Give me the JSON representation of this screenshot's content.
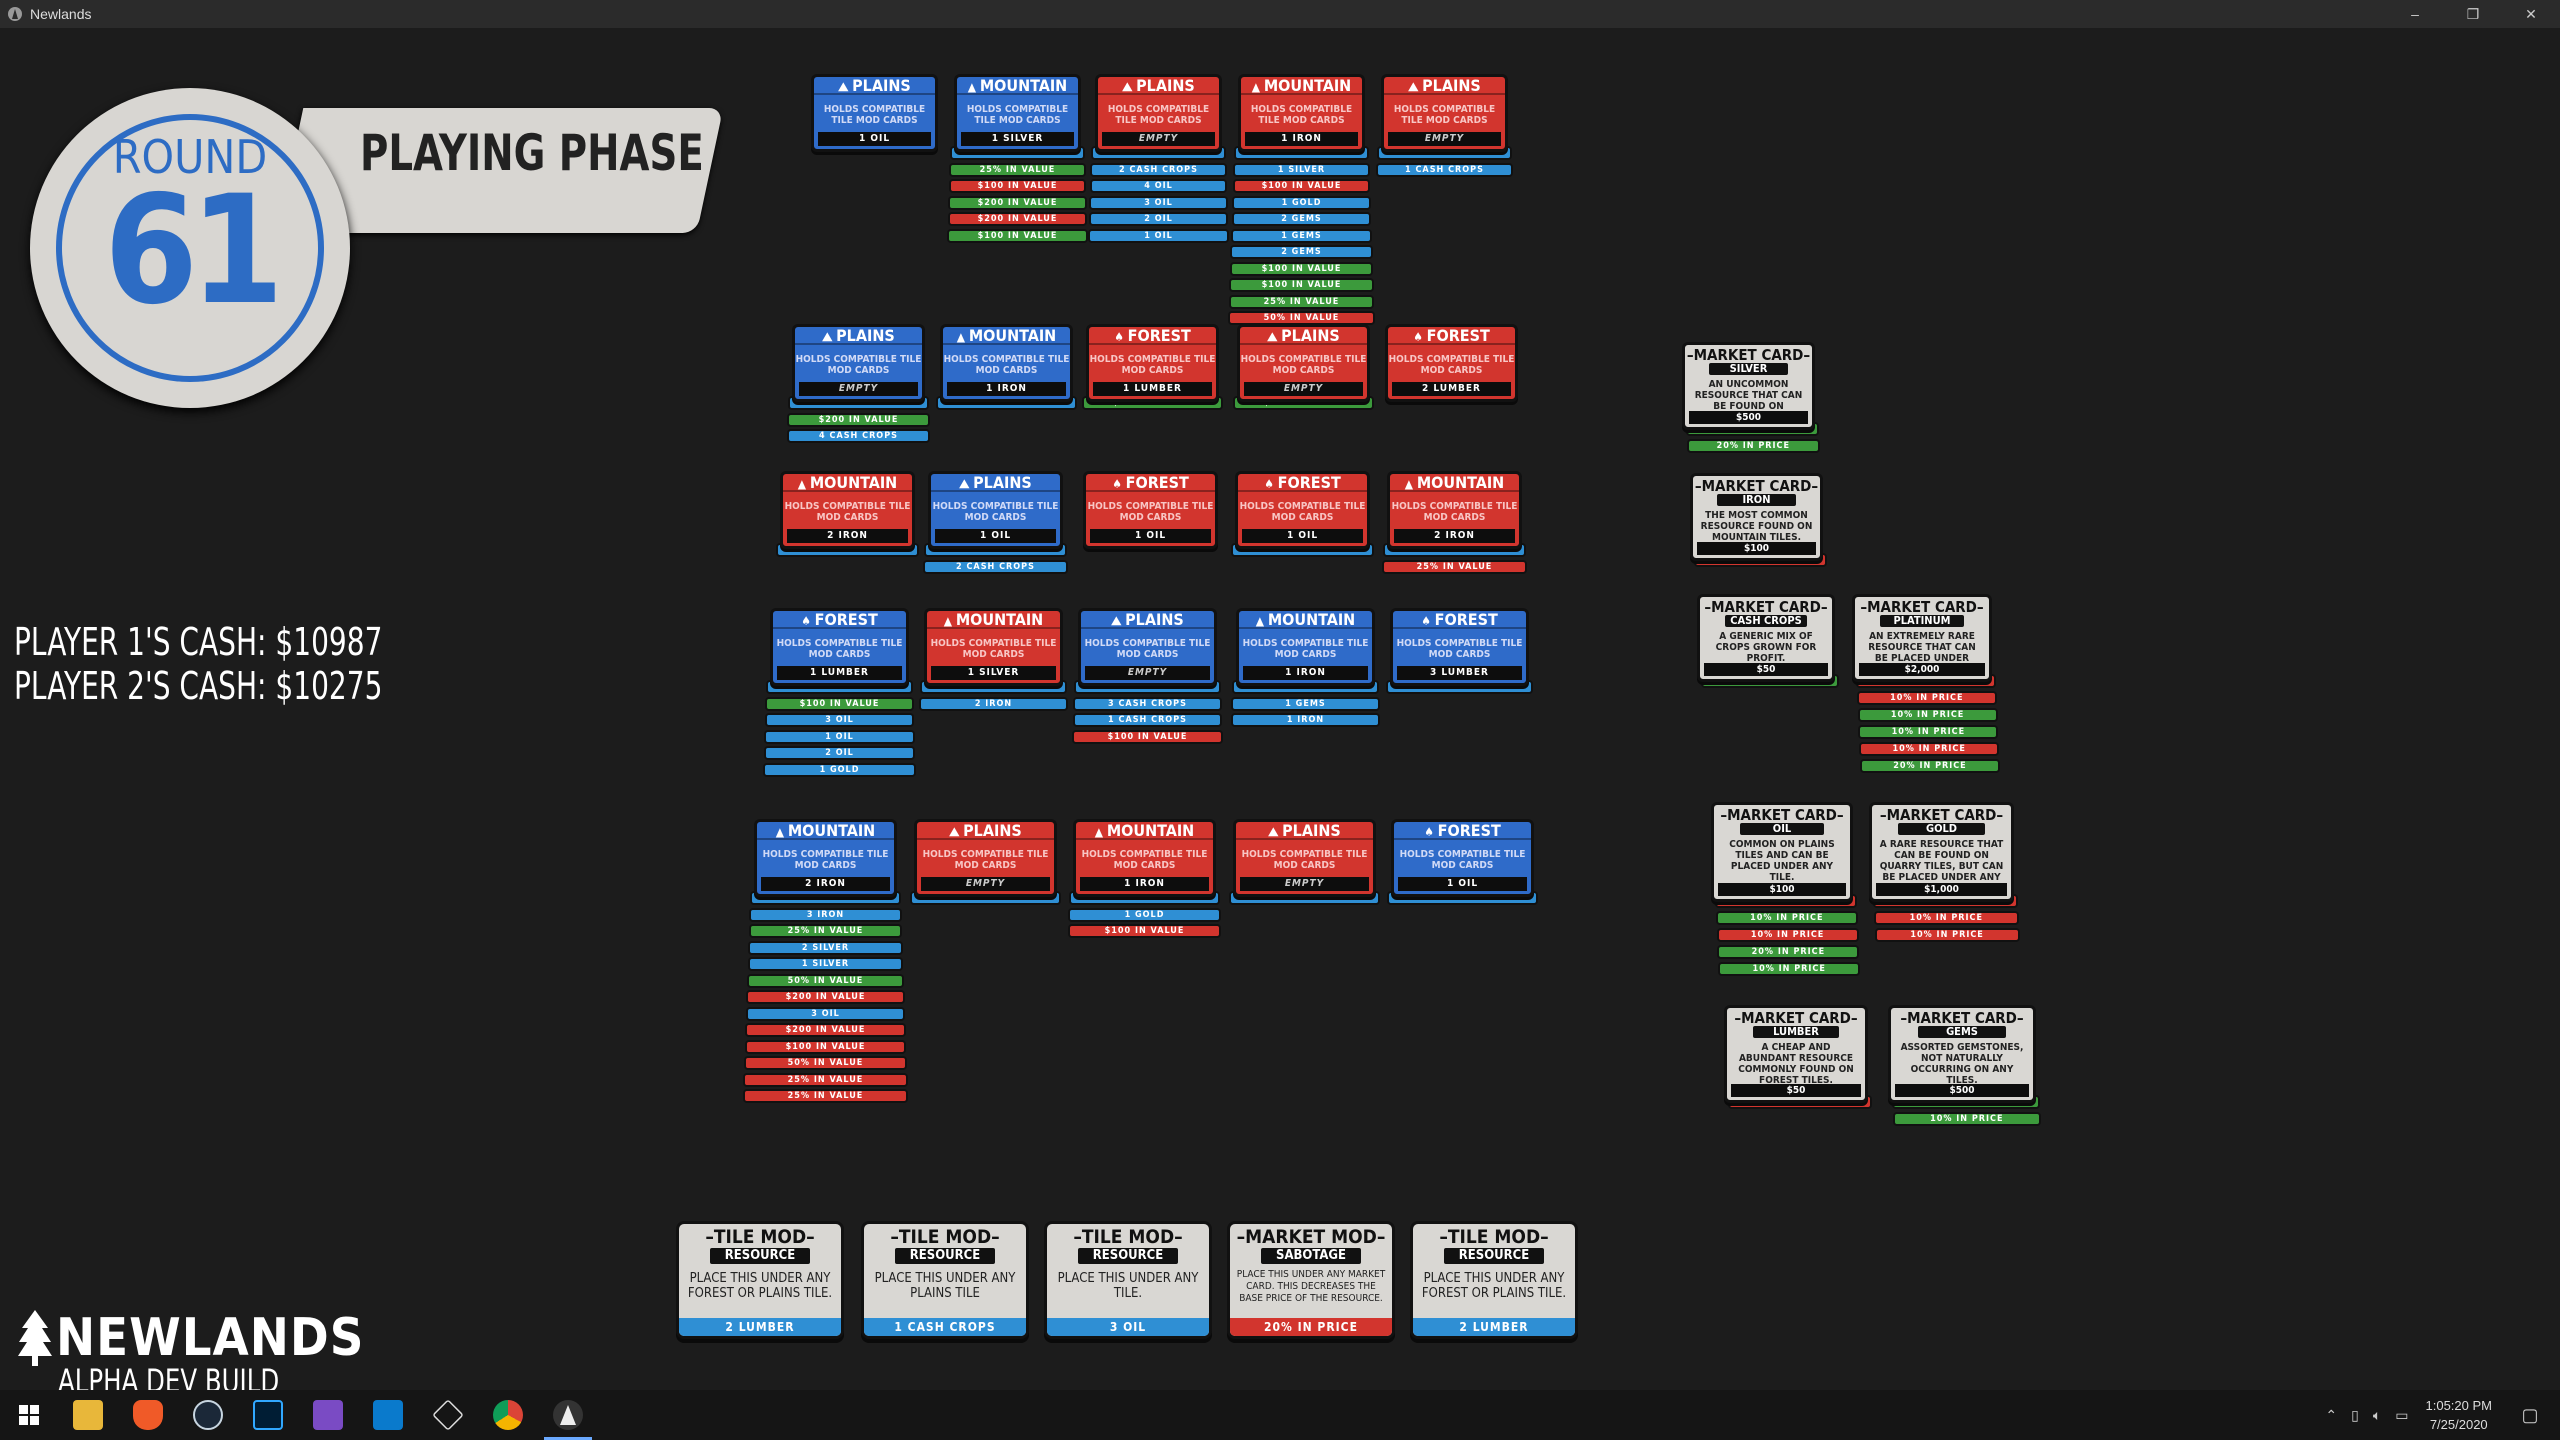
{
  "window": {
    "title": "Newlands",
    "controls": [
      "–",
      "❐",
      "✕"
    ]
  },
  "round": {
    "label": "ROUND",
    "number": "61",
    "phase": "PLAYING PHASE"
  },
  "cash": {
    "player1": "PLAYER 1'S CASH: $10987",
    "player2": "PLAYER 2'S CASH: $10275"
  },
  "logo": {
    "name": "NEWLANDS",
    "subtitle": "ALPHA DEV BUILD"
  },
  "tile_body": "HOLDS COMPATIBLE TILE MOD CARDS",
  "tiles": [
    {
      "type": "PLAINS",
      "owner": "blue",
      "resource": "1 OIL",
      "mods": []
    },
    {
      "type": "MOUNTAIN",
      "owner": "blue",
      "resource": "1 SILVER",
      "mods": [
        {
          "t": "4 OIL",
          "c": "blue"
        },
        {
          "t": "25% IN VALUE",
          "c": "green"
        },
        {
          "t": "$100 IN VALUE",
          "c": "red"
        },
        {
          "t": "$200 IN VALUE",
          "c": "green"
        },
        {
          "t": "$200 IN VALUE",
          "c": "red"
        },
        {
          "t": "$100 IN VALUE",
          "c": "green"
        }
      ]
    },
    {
      "type": "PLAINS",
      "owner": "red",
      "resource": "EMPTY",
      "mods": [
        {
          "t": "1 CASH CROPS",
          "c": "blue"
        },
        {
          "t": "2 CASH CROPS",
          "c": "blue"
        },
        {
          "t": "4 OIL",
          "c": "blue"
        },
        {
          "t": "3 OIL",
          "c": "blue"
        },
        {
          "t": "2 OIL",
          "c": "blue"
        },
        {
          "t": "1 OIL",
          "c": "blue"
        }
      ]
    },
    {
      "type": "MOUNTAIN",
      "owner": "red",
      "resource": "1 IRON",
      "mods": [
        {
          "t": "1 GEMS",
          "c": "blue"
        },
        {
          "t": "1 SILVER",
          "c": "blue"
        },
        {
          "t": "$100 IN VALUE",
          "c": "red"
        },
        {
          "t": "1 GOLD",
          "c": "blue"
        },
        {
          "t": "2 GEMS",
          "c": "blue"
        },
        {
          "t": "1 GEMS",
          "c": "blue"
        },
        {
          "t": "2 GEMS",
          "c": "blue"
        },
        {
          "t": "$100 IN VALUE",
          "c": "green"
        },
        {
          "t": "$100 IN VALUE",
          "c": "green"
        },
        {
          "t": "25% IN VALUE",
          "c": "green"
        },
        {
          "t": "50% IN VALUE",
          "c": "red"
        }
      ]
    },
    {
      "type": "PLAINS",
      "owner": "red",
      "resource": "EMPTY",
      "mods": [
        {
          "t": "2 CASH CROPS",
          "c": "blue"
        },
        {
          "t": "1 CASH CROPS",
          "c": "blue"
        }
      ]
    },
    {
      "type": "PLAINS",
      "owner": "blue",
      "resource": "EMPTY",
      "mods": [
        {
          "t": "2 CASH CROPS",
          "c": "blue"
        },
        {
          "t": "$200 IN VALUE",
          "c": "green"
        },
        {
          "t": "4 CASH CROPS",
          "c": "blue"
        }
      ]
    },
    {
      "type": "MOUNTAIN",
      "owner": "blue",
      "resource": "1 IRON",
      "mods": [
        {
          "t": "2 SILVER",
          "c": "blue"
        }
      ]
    },
    {
      "type": "FOREST",
      "owner": "red",
      "resource": "1 LUMBER",
      "mods": [
        {
          "t": "$100 IN VALUE",
          "c": "green"
        }
      ]
    },
    {
      "type": "PLAINS",
      "owner": "red",
      "resource": "EMPTY",
      "mods": [
        {
          "t": "$100 IN VALUE",
          "c": "green"
        }
      ]
    },
    {
      "type": "FOREST",
      "owner": "red",
      "resource": "2 LUMBER",
      "mods": []
    },
    {
      "type": "MOUNTAIN",
      "owner": "red",
      "resource": "2 IRON",
      "mods": [
        {
          "t": "1 SILVER",
          "c": "blue"
        }
      ]
    },
    {
      "type": "PLAINS",
      "owner": "blue",
      "resource": "1 OIL",
      "mods": [
        {
          "t": "2 LUMBER",
          "c": "blue"
        },
        {
          "t": "2 CASH CROPS",
          "c": "blue"
        }
      ]
    },
    {
      "type": "FOREST",
      "owner": "red",
      "resource": "1 OIL",
      "mods": []
    },
    {
      "type": "FOREST",
      "owner": "red",
      "resource": "1 OIL",
      "mods": [
        {
          "t": "4 OIL",
          "c": "blue"
        }
      ]
    },
    {
      "type": "MOUNTAIN",
      "owner": "red",
      "resource": "2 IRON",
      "mods": [
        {
          "t": "1 PLATINUM",
          "c": "blue"
        },
        {
          "t": "25% IN VALUE",
          "c": "red"
        }
      ]
    },
    {
      "type": "FOREST",
      "owner": "blue",
      "resource": "1 LUMBER",
      "mods": [
        {
          "t": "2 OIL",
          "c": "blue"
        },
        {
          "t": "$100 IN VALUE",
          "c": "green"
        },
        {
          "t": "3 OIL",
          "c": "blue"
        },
        {
          "t": "1 OIL",
          "c": "blue"
        },
        {
          "t": "2 OIL",
          "c": "blue"
        },
        {
          "t": "1 GOLD",
          "c": "blue"
        }
      ]
    },
    {
      "type": "MOUNTAIN",
      "owner": "red",
      "resource": "1 SILVER",
      "mods": [
        {
          "t": "1 IRON",
          "c": "blue"
        },
        {
          "t": "2 IRON",
          "c": "blue"
        }
      ]
    },
    {
      "type": "PLAINS",
      "owner": "blue",
      "resource": "EMPTY",
      "mods": [
        {
          "t": "2 OIL",
          "c": "blue"
        },
        {
          "t": "3 CASH CROPS",
          "c": "blue"
        },
        {
          "t": "1 CASH CROPS",
          "c": "blue"
        },
        {
          "t": "$100 IN VALUE",
          "c": "red"
        }
      ]
    },
    {
      "type": "MOUNTAIN",
      "owner": "blue",
      "resource": "1 IRON",
      "mods": [
        {
          "t": "2 IRON",
          "c": "blue"
        },
        {
          "t": "1 GEMS",
          "c": "blue"
        },
        {
          "t": "1 IRON",
          "c": "blue"
        }
      ]
    },
    {
      "type": "FOREST",
      "owner": "blue",
      "resource": "3 LUMBER",
      "mods": [
        {
          "t": "3 LUMBER",
          "c": "blue"
        }
      ]
    },
    {
      "type": "MOUNTAIN",
      "owner": "blue",
      "resource": "2 IRON",
      "mods": [
        {
          "t": "2 SILVER",
          "c": "blue"
        },
        {
          "t": "3 IRON",
          "c": "blue"
        },
        {
          "t": "25% IN VALUE",
          "c": "green"
        },
        {
          "t": "2 SILVER",
          "c": "blue"
        },
        {
          "t": "1 SILVER",
          "c": "blue"
        },
        {
          "t": "50% IN VALUE",
          "c": "green"
        },
        {
          "t": "$200 IN VALUE",
          "c": "red"
        },
        {
          "t": "3 OIL",
          "c": "blue"
        },
        {
          "t": "$200 IN VALUE",
          "c": "red"
        },
        {
          "t": "$100 IN VALUE",
          "c": "red"
        },
        {
          "t": "50% IN VALUE",
          "c": "red"
        },
        {
          "t": "25% IN VALUE",
          "c": "red"
        },
        {
          "t": "25% IN VALUE",
          "c": "red"
        }
      ]
    },
    {
      "type": "PLAINS",
      "owner": "red",
      "resource": "EMPTY",
      "mods": [
        {
          "t": "1 CASH CROPS",
          "c": "blue"
        }
      ]
    },
    {
      "type": "MOUNTAIN",
      "owner": "red",
      "resource": "1 IRON",
      "mods": [
        {
          "t": "3 IRON",
          "c": "blue"
        },
        {
          "t": "1 GOLD",
          "c": "blue"
        },
        {
          "t": "$100 IN VALUE",
          "c": "red"
        }
      ]
    },
    {
      "type": "PLAINS",
      "owner": "red",
      "resource": "EMPTY",
      "mods": [
        {
          "t": "3 LUMBER",
          "c": "blue"
        }
      ]
    },
    {
      "type": "FOREST",
      "owner": "blue",
      "resource": "1 OIL",
      "mods": [
        {
          "t": "1 OIL",
          "c": "blue"
        }
      ]
    }
  ],
  "market_cards": [
    {
      "title": "MARKET CARD",
      "sub": "SILVER",
      "desc": "AN UNCOMMON RESOURCE THAT CAN BE FOUND ON MOUNTAIN TILES.",
      "price": "$500",
      "mods": [
        {
          "t": "20% IN PRICE",
          "c": "green"
        },
        {
          "t": "20% IN PRICE",
          "c": "green"
        }
      ]
    },
    {
      "title": "MARKET CARD",
      "sub": "IRON",
      "desc": "THE MOST COMMON RESOURCE FOUND ON MOUNTAIN TILES.",
      "price": "$100",
      "mods": [
        {
          "t": "10% IN PRICE",
          "c": "red"
        }
      ]
    },
    {
      "title": "MARKET CARD",
      "sub": "CASH CROPS",
      "desc": "A GENERIC MIX OF CROPS GROWN FOR PROFIT.",
      "price": "$50",
      "mods": [
        {
          "t": "20% IN PRICE",
          "c": "green"
        }
      ]
    },
    {
      "title": "MARKET CARD",
      "sub": "PLATINUM",
      "desc": "AN EXTREMELY RARE RESOURCE THAT CAN BE PLACED UNDER MOUNTAIN TILES.",
      "price": "$2,000",
      "mods": [
        {
          "t": "20% IN PRICE",
          "c": "red"
        },
        {
          "t": "10% IN PRICE",
          "c": "red"
        },
        {
          "t": "10% IN PRICE",
          "c": "green"
        },
        {
          "t": "10% IN PRICE",
          "c": "green"
        },
        {
          "t": "10% IN PRICE",
          "c": "red"
        },
        {
          "t": "20% IN PRICE",
          "c": "green"
        }
      ]
    },
    {
      "title": "MARKET CARD",
      "sub": "OIL",
      "desc": "COMMON ON PLAINS TILES AND CAN BE PLACED UNDER ANY TILE.",
      "price": "$100",
      "mods": [
        {
          "t": "20% IN PRICE",
          "c": "red"
        },
        {
          "t": "10% IN PRICE",
          "c": "green"
        },
        {
          "t": "10% IN PRICE",
          "c": "red"
        },
        {
          "t": "20% IN PRICE",
          "c": "green"
        },
        {
          "t": "10% IN PRICE",
          "c": "green"
        }
      ]
    },
    {
      "title": "MARKET CARD",
      "sub": "GOLD",
      "desc": "A RARE RESOURCE THAT CAN BE FOUND ON QUARRY TILES, BUT CAN BE PLACED UNDER ANY TILE.",
      "price": "$1,000",
      "mods": [
        {
          "t": "10% IN PRICE",
          "c": "red"
        },
        {
          "t": "10% IN PRICE",
          "c": "red"
        },
        {
          "t": "10% IN PRICE",
          "c": "red"
        }
      ]
    },
    {
      "title": "MARKET CARD",
      "sub": "LUMBER",
      "desc": "A CHEAP AND ABUNDANT RESOURCE COMMONLY FOUND ON FOREST TILES.",
      "price": "$50",
      "mods": [
        {
          "t": "10% IN PRICE",
          "c": "red"
        }
      ]
    },
    {
      "title": "MARKET CARD",
      "sub": "GEMS",
      "desc": "ASSORTED GEMSTONES, NOT NATURALLY OCCURRING ON ANY TILES.",
      "price": "$500",
      "mods": [
        {
          "t": "10% IN PRICE",
          "c": "green"
        },
        {
          "t": "10% IN PRICE",
          "c": "green"
        }
      ]
    }
  ],
  "hand": [
    {
      "title": "TILE MOD",
      "sub": "RESOURCE",
      "desc": "PLACE THIS UNDER ANY FOREST OR PLAINS TILE.",
      "foot": "2 LUMBER",
      "footColor": "blue"
    },
    {
      "title": "TILE MOD",
      "sub": "RESOURCE",
      "desc": "PLACE THIS UNDER ANY PLAINS TILE",
      "foot": "1 CASH CROPS",
      "footColor": "blue"
    },
    {
      "title": "TILE MOD",
      "sub": "RESOURCE",
      "desc": "PLACE THIS UNDER ANY TILE.",
      "foot": "3 OIL",
      "footColor": "blue"
    },
    {
      "title": "MARKET MOD",
      "sub": "SABOTAGE",
      "desc": "PLACE THIS UNDER ANY MARKET CARD. THIS DECREASES THE BASE PRICE OF THE RESOURCE.",
      "foot": "20% IN PRICE",
      "footColor": "red"
    },
    {
      "title": "TILE MOD",
      "sub": "RESOURCE",
      "desc": "PLACE THIS UNDER ANY FOREST OR PLAINS TILE.",
      "foot": "2 LUMBER",
      "footColor": "blue"
    }
  ],
  "taskbar": {
    "apps": [
      "start",
      "file-explorer",
      "brave",
      "steam",
      "photoshop",
      "visual-studio",
      "vscode",
      "unity",
      "chrome",
      "newlands"
    ],
    "time": "1:05:20 PM",
    "date": "7/25/2020"
  },
  "colors": {
    "blue": "#2f6bc9",
    "red": "#d2352e",
    "green": "#3c9a3c",
    "chip_blue": "#2f8fd4",
    "card": "#d9d7d3"
  }
}
